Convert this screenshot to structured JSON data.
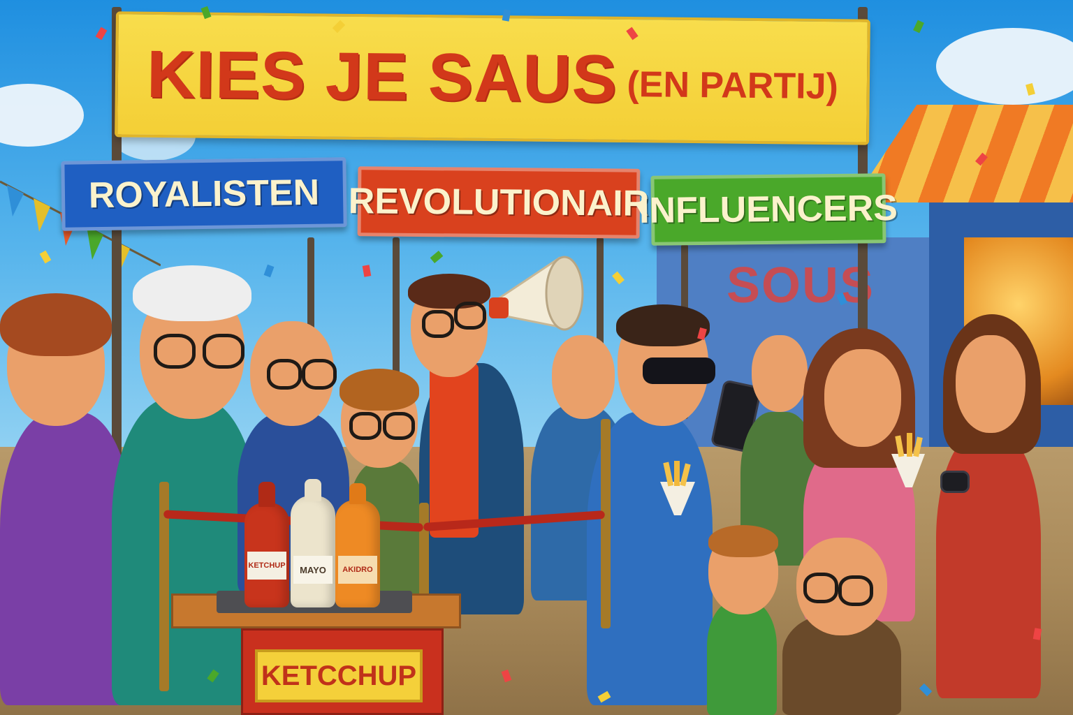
{
  "banner": {
    "main": "KIES JE SAUS",
    "sub": "(EN PARTIJ)"
  },
  "signs": [
    {
      "label": "ROYALISTEN",
      "color": "#1f5fc2"
    },
    {
      "label": "REVOLUTIONAIR",
      "color": "#d9411e"
    },
    {
      "label": "INFLUENCERS",
      "color": "#4aa82a"
    }
  ],
  "wall_graffiti": "SOUS",
  "stand": {
    "label": "KETCCHUP"
  },
  "bottles": [
    {
      "label": "KETCHUP",
      "color": "#c8341c"
    },
    {
      "label": "MAYO",
      "color": "#ece4cc"
    },
    {
      "label": "AKIDRO",
      "color": "#ee8a24"
    }
  ],
  "palette": {
    "banner_yellow": "#f4cf36",
    "banner_text_red": "#d2381a",
    "stall_orange": "#f07a24"
  }
}
